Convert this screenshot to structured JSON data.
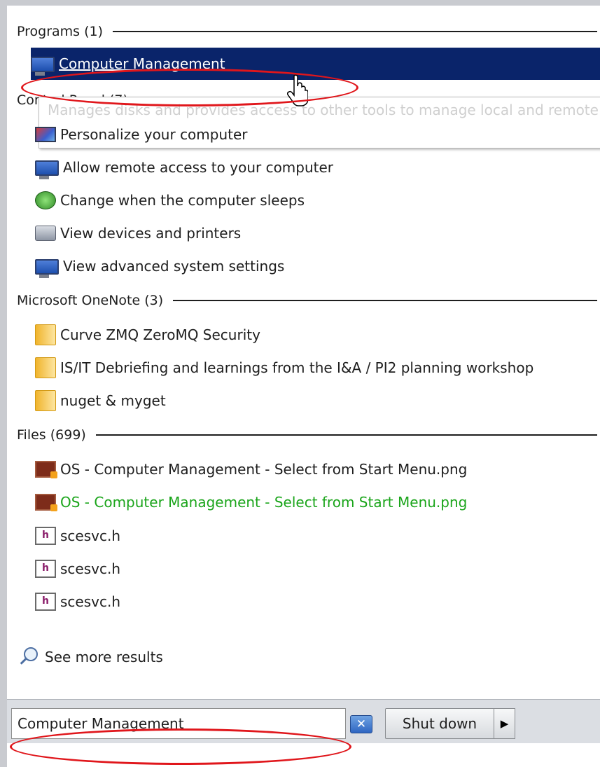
{
  "groups": {
    "programs": {
      "label": "Programs (1)"
    },
    "control_panel": {
      "label": "Control Panel (7)"
    },
    "onenote": {
      "label": "Microsoft OneNote (3)"
    },
    "files": {
      "label": "Files (699)"
    }
  },
  "programs_items": [
    {
      "label": "Computer Management",
      "icon": "computer-management-icon",
      "selected": true
    }
  ],
  "tooltip": {
    "text": "Manages disks and provides access to other tools to manage local and remote"
  },
  "control_panel_items": [
    {
      "label": "Personalize your computer",
      "icon": "personalize-icon"
    },
    {
      "label": "Allow remote access to your computer",
      "icon": "system-monitor-icon"
    },
    {
      "label": "Change when the computer sleeps",
      "icon": "power-sleep-icon"
    },
    {
      "label": "View devices and printers",
      "icon": "printer-icon"
    },
    {
      "label": "View advanced system settings",
      "icon": "system-monitor-icon"
    }
  ],
  "onenote_items": [
    {
      "label": "Curve ZMQ ZeroMQ Security",
      "icon": "folder-icon"
    },
    {
      "label": "IS/IT Debriefing and learnings from the I&A / PI2 planning workshop",
      "icon": "folder-icon"
    },
    {
      "label": "nuget & myget",
      "icon": "folder-icon"
    }
  ],
  "files_items": [
    {
      "label": "OS - Computer Management - Select from Start Menu.png",
      "icon": "image-file-icon"
    },
    {
      "label": "OS - Computer Management - Select from Start Menu.png",
      "icon": "image-file-icon",
      "highlight_color": "#1ba51b"
    },
    {
      "label": "scesvc.h",
      "icon": "h-file-icon"
    },
    {
      "label": "scesvc.h",
      "icon": "h-file-icon"
    },
    {
      "label": "scesvc.h",
      "icon": "h-file-icon"
    }
  ],
  "see_more": {
    "label": "See more results",
    "icon": "search-icon"
  },
  "search": {
    "value": "Computer Management",
    "clear_icon": "close-icon"
  },
  "shutdown": {
    "label": "Shut down",
    "arrow_icon": "triangle-right-icon"
  },
  "colors": {
    "selection": "#0a246a",
    "annotation": "#e0161b",
    "green_text": "#1ba51b"
  }
}
